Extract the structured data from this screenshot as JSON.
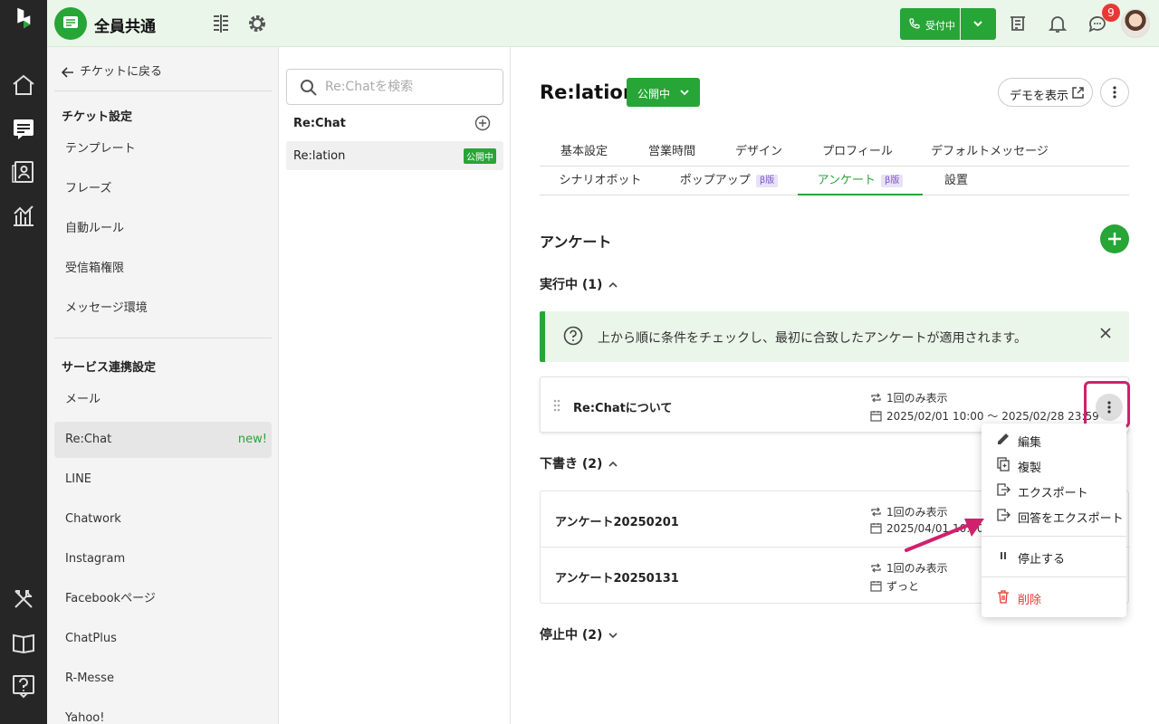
{
  "header": {
    "workspace_name": "全員共通",
    "call_status": "受付中",
    "notification_count": "9"
  },
  "sidebar": {
    "back_label": "チケットに戻る",
    "ticket_settings_heading": "チケット設定",
    "ticket_items": [
      "テンプレート",
      "フレーズ",
      "自動ルール",
      "受信箱権限",
      "メッセージ環境"
    ],
    "service_heading": "サービス連携設定",
    "service_items": [
      "メール",
      "Re:Chat",
      "LINE",
      "Chatwork",
      "Instagram",
      "Facebookページ",
      "ChatPlus",
      "R-Messe",
      "Yahoo!"
    ],
    "new_label": "new!"
  },
  "channel_list": {
    "search_placeholder": "Re:Chatを検索",
    "group_title": "Re:Chat",
    "item_name": "Re:lation",
    "item_status": "公開中"
  },
  "main": {
    "title": "Re:lation",
    "status_label": "公開中",
    "demo_label": "デモを表示",
    "tabs_row1": [
      "基本設定",
      "営業時間",
      "デザイン",
      "プロフィール",
      "デフォルトメッセージ"
    ],
    "tabs_row2": [
      "シナリオボット",
      "ポップアップ",
      "アンケート",
      "設置"
    ],
    "beta_label": "β版",
    "section_title": "アンケート",
    "running_label": "実行中 (1)",
    "info_text": "上から順に条件をチェックし、最初に合致したアンケートが適用されます。",
    "running": [
      {
        "name": "Re:Chatについて",
        "display": "1回のみ表示",
        "period": "2025/02/01 10:00 〜 2025/02/28 23:59"
      }
    ],
    "draft_label": "下書き (2)",
    "drafts": [
      {
        "name": "アンケート20250201",
        "display": "1回のみ表示",
        "period": "2025/04/01 10:00"
      },
      {
        "name": "アンケート20250131",
        "display": "1回のみ表示",
        "period": "ずっと"
      }
    ],
    "stopped_label": "停止中 (2)"
  },
  "menu": {
    "edit": "編集",
    "duplicate": "複製",
    "export": "エクスポート",
    "export_answers": "回答をエクスポート",
    "stop": "停止する",
    "delete": "削除"
  },
  "colors": {
    "brand_green": "#27a537",
    "highlight": "#d0216e",
    "danger": "#e53935"
  }
}
